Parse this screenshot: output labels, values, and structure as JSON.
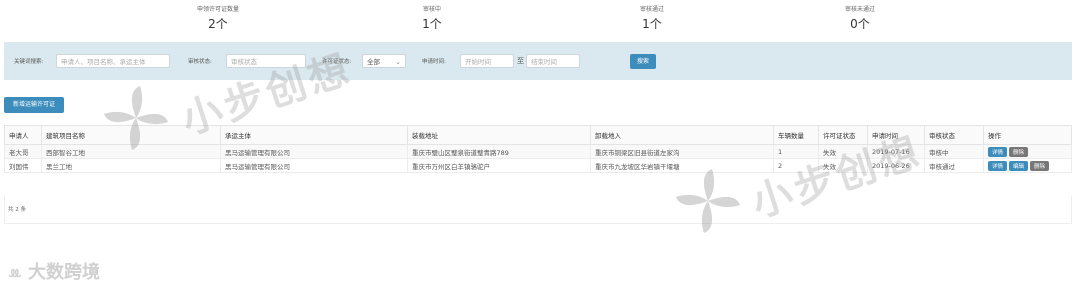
{
  "stats": [
    {
      "label": "申领许可证数量",
      "value": "2个"
    },
    {
      "label": "审核中",
      "value": "1个"
    },
    {
      "label": "审核通过",
      "value": "1个"
    },
    {
      "label": "审核未通过",
      "value": "0个"
    }
  ],
  "filter": {
    "keyword_label": "关键词搜索:",
    "keyword_placeholder": "申请人、项目名称、承运主体",
    "audit_label": "审核状态:",
    "audit_value": "审核状态",
    "permit_label": "许可证状态:",
    "permit_value": "全部",
    "time_label": "申请时间:",
    "start_placeholder": "开始时间",
    "to": "至",
    "end_placeholder": "结束时间",
    "search_btn": "搜索"
  },
  "add_btn": "新增运输许可证",
  "table": {
    "headers": [
      "申请人",
      "建筑项目名称",
      "承运主体",
      "装载地址",
      "卸载地入",
      "车辆数量",
      "许可证状态",
      "申请时间",
      "审核状态",
      "操作"
    ],
    "rows": [
      {
        "applicant": "老大哥",
        "project": "西部智谷工地",
        "carrier": "黑马运输管理有限公司",
        "load": "重庆市璧山区璧泉街道璧青路789",
        "unload": "重庆市铜梁区旧县街道左家沟",
        "count": "1",
        "permit": "失效",
        "time": "2019-07-16",
        "audit": "审核中",
        "actions": [
          "详情",
          "删除"
        ]
      },
      {
        "applicant": "刘国伟",
        "project": "黑兰工地",
        "carrier": "黑马运输管理有限公司",
        "load": "重庆市万州区白羊镇骆驼户",
        "unload": "重庆市九龙坡区华岩镇干堰塘",
        "count": "2",
        "permit": "失效",
        "time": "2019-06-26",
        "audit": "审核通过",
        "actions": [
          "详情",
          "编辑",
          "删除"
        ]
      }
    ],
    "total": "共 2 条"
  },
  "watermark": "小步创想",
  "brand": "大数跨境"
}
